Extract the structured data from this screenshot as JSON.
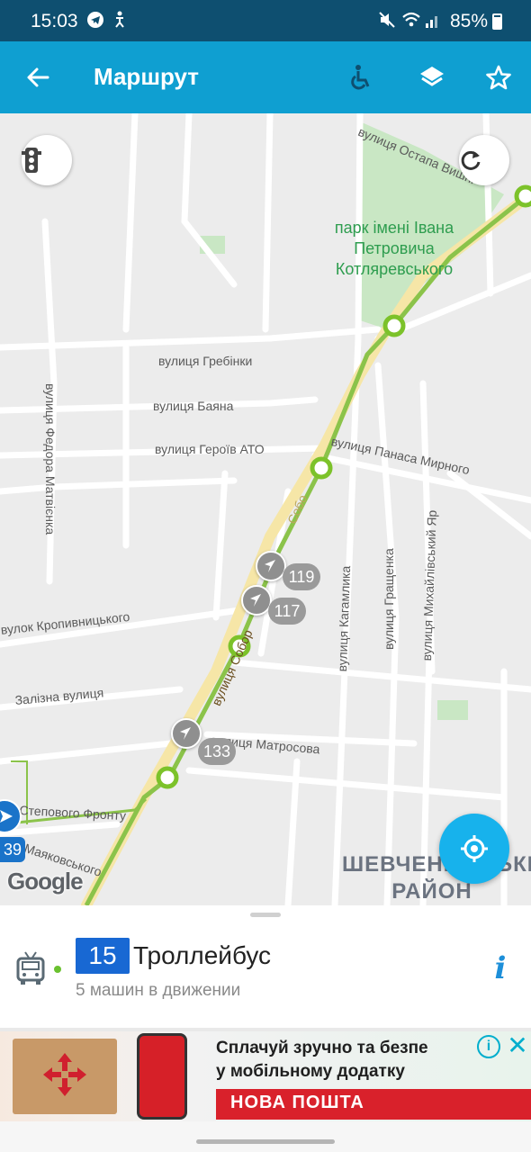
{
  "status_bar": {
    "time": "15:03",
    "battery": "85%",
    "icons": [
      "telegram-icon",
      "accessibility-icon",
      "mute-icon",
      "wifi-icon",
      "signal-icon",
      "battery-icon"
    ]
  },
  "app_bar": {
    "title": "Маршрут",
    "icons": [
      "back-arrow-icon",
      "wheelchair-icon",
      "layers-icon",
      "star-icon"
    ],
    "accent": "#0f9fd1"
  },
  "map": {
    "labels": {
      "ostapa_vyshni": "вулиця Остапа Вишні",
      "hrebinky": "вулиця Гребінки",
      "bayana": "вулиця Баяна",
      "heroiv_ato": "вулиця Героїв АТО",
      "panasa_myrnoho": "вулиця Панаса Мирного",
      "fedora_matviienka": "вулиця Федора Матвієнка",
      "kropyvnytskoho": "вулок Кропивницького",
      "zalizna": "Залізна вулиця",
      "matrosova": "вулиця Матросова",
      "stepovoho_frontu": "Степового Фронту",
      "maiakovskoho": "Маяковського",
      "kahamlyk": "вулиця Кагамлика",
      "hrashchenka": "вулиця Гращенка",
      "mykhailivskyi_yar": "вулиця Михайлівський Яр",
      "soborna_fragment": "вулиця Собор",
      "soborna_short": "Собо"
    },
    "park": [
      "парк імені Івана",
      "Петровича",
      "Котляревського"
    ],
    "district": [
      "ШЕВЧЕНКІВСЬКИЙ",
      "РАЙОН"
    ],
    "vehicles": [
      "119",
      "117",
      "133"
    ],
    "edge_vehicle_number": "39",
    "google": "Google",
    "route_color": "#8bc34a",
    "stop_color": "#7cc22a"
  },
  "route_panel": {
    "number": "15",
    "type": "Троллейбус",
    "subtitle": "5 машин в движении",
    "badge_color": "#1868d3"
  },
  "ad": {
    "line1": "Сплачуй зручно та безпе",
    "line2": "у мобільному додатку",
    "brand": "НОВА ПОШТА",
    "info": "i",
    "close": "✕"
  }
}
